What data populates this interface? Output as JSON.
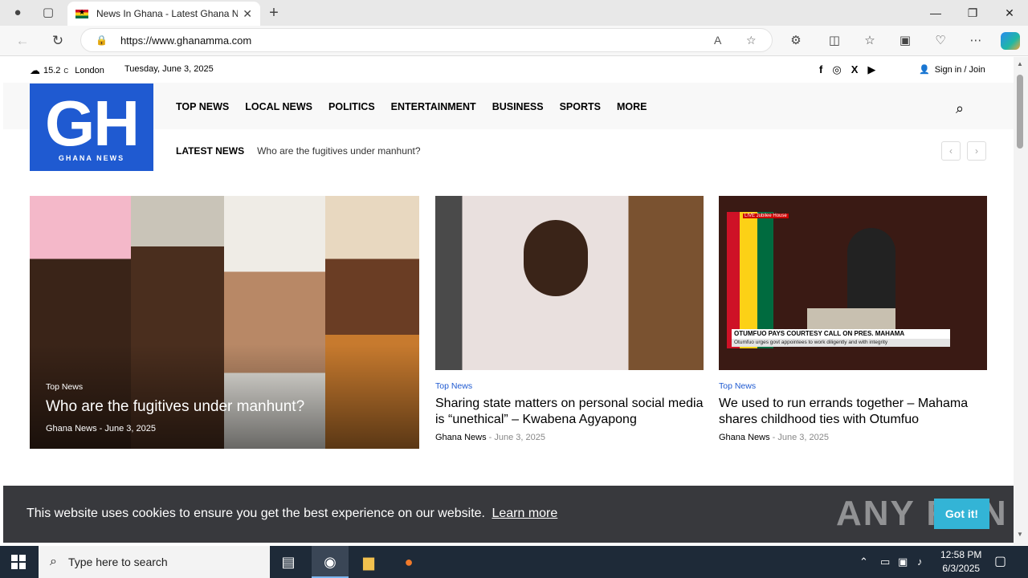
{
  "browser": {
    "tab_title": "News In Ghana - Latest Ghana News",
    "url": "https://www.ghanamma.com",
    "new_tab": "+",
    "tab_close": "✕"
  },
  "site": {
    "weather": {
      "temp": "15.2",
      "unit": "C",
      "city": "London"
    },
    "date": "Tuesday, June 3, 2025",
    "signin": "Sign in / Join",
    "logo": {
      "text": "GH",
      "subtitle": "GHANA NEWS"
    },
    "menu": [
      "TOP NEWS",
      "LOCAL NEWS",
      "POLITICS",
      "ENTERTAINMENT",
      "BUSINESS",
      "SPORTS",
      "MORE"
    ],
    "latest": {
      "label": "LATEST NEWS",
      "headline": "Who are the fugitives under manhunt?"
    }
  },
  "articles": {
    "featured": {
      "category": "Top News",
      "title": "Who are the fugitives under manhunt?",
      "author": "Ghana News",
      "date": "June 3, 2025"
    },
    "card1": {
      "category": "Top News",
      "title": "Sharing state matters on personal social media is “unethical” – Kwabena Agyapong",
      "author": "Ghana News",
      "date": "June 3, 2025"
    },
    "card2": {
      "category": "Top News",
      "title": "We used to run errands together – Mahama shares childhood ties with Otumfuo",
      "author": "Ghana News",
      "date": "June 3, 2025",
      "tv_banner": "OTUMFUO PAYS COURTESY CALL ON PRES. MAHAMA",
      "tv_sub": "Otumfuo urges govt appointees to work diligently and with integrity",
      "tv_live": "LIVE  Jubilee House"
    }
  },
  "cookie": {
    "message": "This website uses cookies to ensure you get the best experience on our website.",
    "learn_more": "Learn more",
    "button": "Got it!",
    "watermark": "ANY RUN"
  },
  "taskbar": {
    "search_placeholder": "Type here to search",
    "time": "12:58 PM",
    "date": "6/3/2025"
  },
  "colors": {
    "accent": "#1f5ad1",
    "cookie_bg": "#38393d",
    "cookie_btn": "#33b4d6",
    "taskbar": "#1e2a38"
  }
}
